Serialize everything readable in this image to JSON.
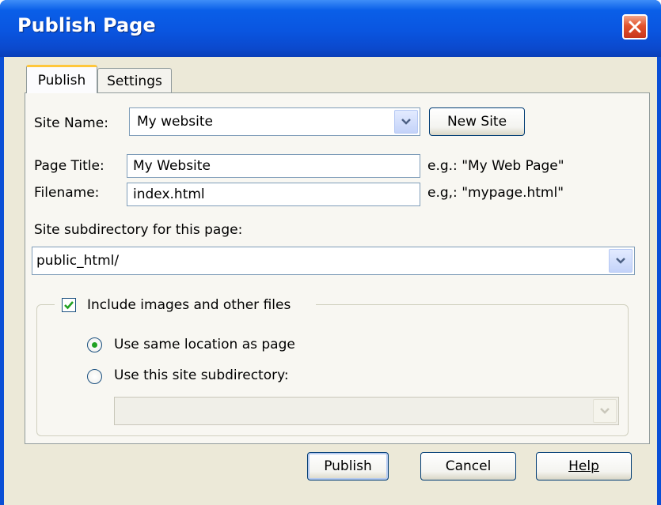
{
  "window": {
    "title": "Publish Page",
    "close_icon": "close-x-icon"
  },
  "tabs": [
    {
      "label": "Publish",
      "active": true
    },
    {
      "label": "Settings",
      "active": false
    }
  ],
  "form": {
    "site_name_label": "Site Name:",
    "site_name_value": "My website",
    "new_site_label": "New Site",
    "page_title_label": "Page Title:",
    "page_title_value": "My Website",
    "page_title_hint": "e.g.: \"My Web Page\"",
    "filename_label": "Filename:",
    "filename_value": "index.html",
    "filename_hint": "e.g,: \"mypage.html\"",
    "subdir_label": "Site subdirectory for this page:",
    "subdir_value": "public_html/"
  },
  "files_group": {
    "include_label": "Include images and other files",
    "include_checked": true,
    "option_same_label": "Use same location as page",
    "option_same_selected": true,
    "option_subdir_label": "Use this site subdirectory:",
    "option_subdir_selected": false,
    "subdir_value": ""
  },
  "buttons": {
    "publish": "Publish",
    "cancel": "Cancel",
    "help": "Help"
  },
  "colors": {
    "titlebar": "#0a55e0",
    "face": "#ece9d8",
    "check": "#21a121"
  }
}
